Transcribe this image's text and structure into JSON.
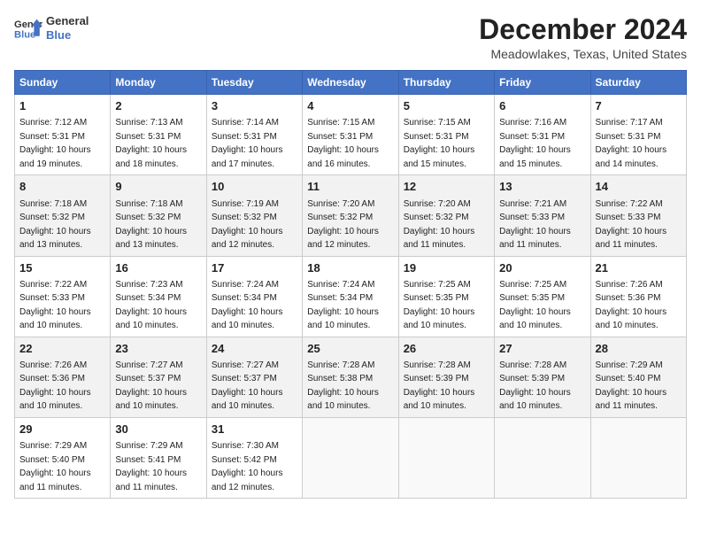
{
  "header": {
    "logo_line1": "General",
    "logo_line2": "Blue",
    "month_title": "December 2024",
    "location": "Meadowlakes, Texas, United States"
  },
  "columns": [
    "Sunday",
    "Monday",
    "Tuesday",
    "Wednesday",
    "Thursday",
    "Friday",
    "Saturday"
  ],
  "weeks": [
    [
      {
        "day": "1",
        "sunrise": "7:12 AM",
        "sunset": "5:31 PM",
        "daylight": "10 hours and 19 minutes."
      },
      {
        "day": "2",
        "sunrise": "7:13 AM",
        "sunset": "5:31 PM",
        "daylight": "10 hours and 18 minutes."
      },
      {
        "day": "3",
        "sunrise": "7:14 AM",
        "sunset": "5:31 PM",
        "daylight": "10 hours and 17 minutes."
      },
      {
        "day": "4",
        "sunrise": "7:15 AM",
        "sunset": "5:31 PM",
        "daylight": "10 hours and 16 minutes."
      },
      {
        "day": "5",
        "sunrise": "7:15 AM",
        "sunset": "5:31 PM",
        "daylight": "10 hours and 15 minutes."
      },
      {
        "day": "6",
        "sunrise": "7:16 AM",
        "sunset": "5:31 PM",
        "daylight": "10 hours and 15 minutes."
      },
      {
        "day": "7",
        "sunrise": "7:17 AM",
        "sunset": "5:31 PM",
        "daylight": "10 hours and 14 minutes."
      }
    ],
    [
      {
        "day": "8",
        "sunrise": "7:18 AM",
        "sunset": "5:32 PM",
        "daylight": "10 hours and 13 minutes."
      },
      {
        "day": "9",
        "sunrise": "7:18 AM",
        "sunset": "5:32 PM",
        "daylight": "10 hours and 13 minutes."
      },
      {
        "day": "10",
        "sunrise": "7:19 AM",
        "sunset": "5:32 PM",
        "daylight": "10 hours and 12 minutes."
      },
      {
        "day": "11",
        "sunrise": "7:20 AM",
        "sunset": "5:32 PM",
        "daylight": "10 hours and 12 minutes."
      },
      {
        "day": "12",
        "sunrise": "7:20 AM",
        "sunset": "5:32 PM",
        "daylight": "10 hours and 11 minutes."
      },
      {
        "day": "13",
        "sunrise": "7:21 AM",
        "sunset": "5:33 PM",
        "daylight": "10 hours and 11 minutes."
      },
      {
        "day": "14",
        "sunrise": "7:22 AM",
        "sunset": "5:33 PM",
        "daylight": "10 hours and 11 minutes."
      }
    ],
    [
      {
        "day": "15",
        "sunrise": "7:22 AM",
        "sunset": "5:33 PM",
        "daylight": "10 hours and 10 minutes."
      },
      {
        "day": "16",
        "sunrise": "7:23 AM",
        "sunset": "5:34 PM",
        "daylight": "10 hours and 10 minutes."
      },
      {
        "day": "17",
        "sunrise": "7:24 AM",
        "sunset": "5:34 PM",
        "daylight": "10 hours and 10 minutes."
      },
      {
        "day": "18",
        "sunrise": "7:24 AM",
        "sunset": "5:34 PM",
        "daylight": "10 hours and 10 minutes."
      },
      {
        "day": "19",
        "sunrise": "7:25 AM",
        "sunset": "5:35 PM",
        "daylight": "10 hours and 10 minutes."
      },
      {
        "day": "20",
        "sunrise": "7:25 AM",
        "sunset": "5:35 PM",
        "daylight": "10 hours and 10 minutes."
      },
      {
        "day": "21",
        "sunrise": "7:26 AM",
        "sunset": "5:36 PM",
        "daylight": "10 hours and 10 minutes."
      }
    ],
    [
      {
        "day": "22",
        "sunrise": "7:26 AM",
        "sunset": "5:36 PM",
        "daylight": "10 hours and 10 minutes."
      },
      {
        "day": "23",
        "sunrise": "7:27 AM",
        "sunset": "5:37 PM",
        "daylight": "10 hours and 10 minutes."
      },
      {
        "day": "24",
        "sunrise": "7:27 AM",
        "sunset": "5:37 PM",
        "daylight": "10 hours and 10 minutes."
      },
      {
        "day": "25",
        "sunrise": "7:28 AM",
        "sunset": "5:38 PM",
        "daylight": "10 hours and 10 minutes."
      },
      {
        "day": "26",
        "sunrise": "7:28 AM",
        "sunset": "5:39 PM",
        "daylight": "10 hours and 10 minutes."
      },
      {
        "day": "27",
        "sunrise": "7:28 AM",
        "sunset": "5:39 PM",
        "daylight": "10 hours and 10 minutes."
      },
      {
        "day": "28",
        "sunrise": "7:29 AM",
        "sunset": "5:40 PM",
        "daylight": "10 hours and 11 minutes."
      }
    ],
    [
      {
        "day": "29",
        "sunrise": "7:29 AM",
        "sunset": "5:40 PM",
        "daylight": "10 hours and 11 minutes."
      },
      {
        "day": "30",
        "sunrise": "7:29 AM",
        "sunset": "5:41 PM",
        "daylight": "10 hours and 11 minutes."
      },
      {
        "day": "31",
        "sunrise": "7:30 AM",
        "sunset": "5:42 PM",
        "daylight": "10 hours and 12 minutes."
      },
      null,
      null,
      null,
      null
    ]
  ]
}
